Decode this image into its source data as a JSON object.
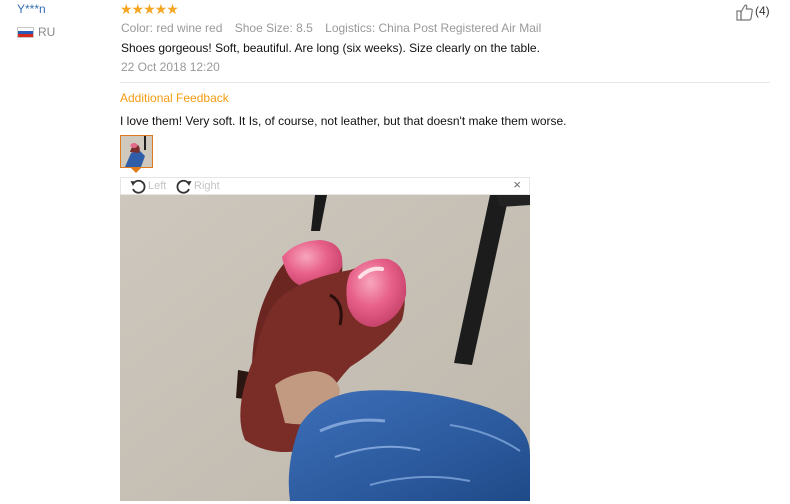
{
  "reviewer": {
    "name": "Y***n",
    "country": "RU"
  },
  "rating": {
    "stars": "★★★★★"
  },
  "attributes": {
    "color": "Color: red wine red",
    "size": "Shoe Size: 8.5",
    "logistics": "Logistics: China Post Registered Air Mail"
  },
  "review": {
    "text": "Shoes gorgeous! Soft, beautiful. Are long (six weeks). Size clearly on the table.",
    "date": "22 Oct 2018 12:20"
  },
  "helpful": {
    "count": "(4)"
  },
  "additional": {
    "label": "Additional Feedback",
    "text": "I love them! Very soft. It Is, of course, not leather, but that doesn't make them worse."
  },
  "viewer": {
    "rotate_left": "Left",
    "rotate_right": "Right",
    "close": "×"
  },
  "colors": {
    "name_link": "#3a6fb5",
    "star": "#f5a623",
    "feedback_label": "#f39c12",
    "thumb_border": "#e07a1a"
  }
}
